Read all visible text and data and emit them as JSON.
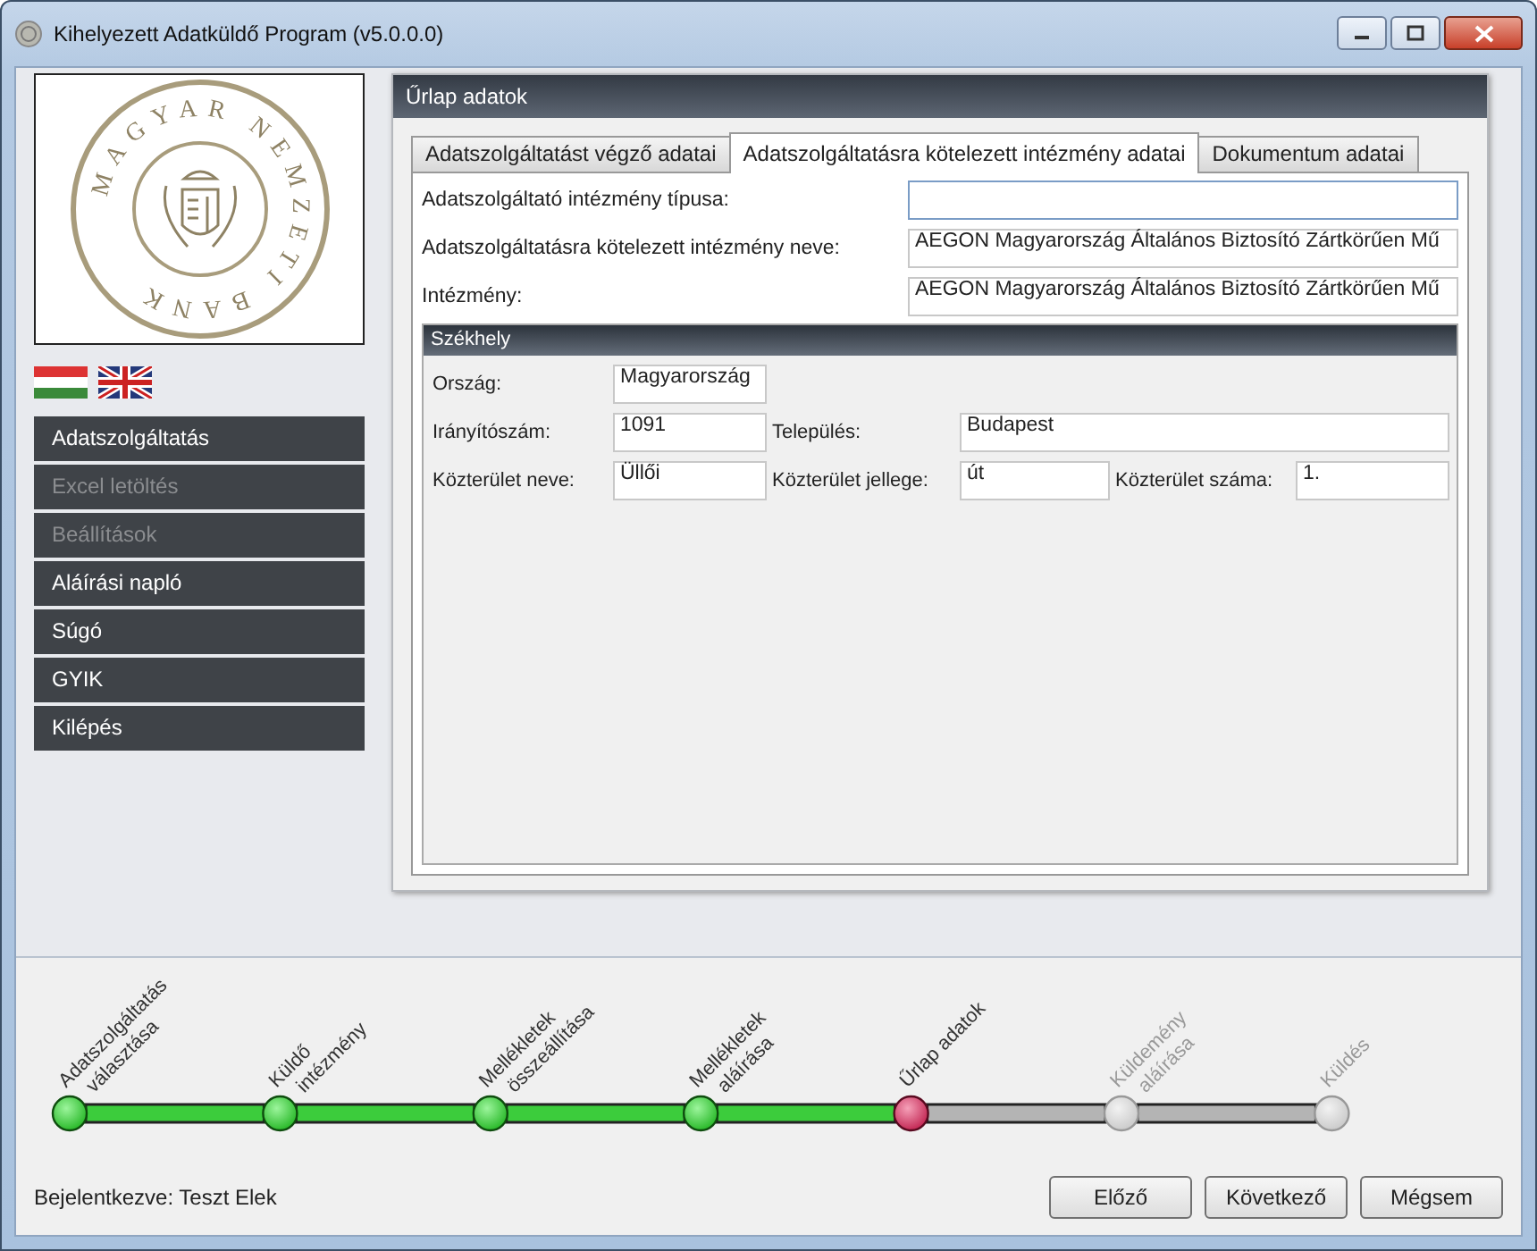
{
  "window": {
    "title": "Kihelyezett Adatküldő Program (v5.0.0.0)"
  },
  "logo": {
    "text": "MAGYAR NEMZETI BANK"
  },
  "menu": [
    {
      "label": "Adatszolgáltatás",
      "disabled": false
    },
    {
      "label": "Excel letöltés",
      "disabled": true
    },
    {
      "label": "Beállítások",
      "disabled": true
    },
    {
      "label": "Aláírási napló",
      "disabled": false
    },
    {
      "label": "Súgó",
      "disabled": false
    },
    {
      "label": "GYIK",
      "disabled": false
    },
    {
      "label": "Kilépés",
      "disabled": false
    }
  ],
  "panel": {
    "title": "Űrlap adatok",
    "tabs": [
      {
        "label": "Adatszolgáltatást végző adatai",
        "selected": false
      },
      {
        "label": "Adatszolgáltatásra kötelezett intézmény adatai",
        "selected": true
      },
      {
        "label": "Dokumentum adatai",
        "selected": false
      }
    ],
    "fields": [
      {
        "label": "Adatszolgáltató intézmény típusa:"
      },
      {
        "label": "Adatszolgáltatásra kötelezett intézmény neve:",
        "value": "AEGON Magyarország Általános Biztosító Zártkörűen Mű"
      },
      {
        "label": "Intézmény:",
        "value": "AEGON Magyarország Általános Biztosító Zártkörűen Mű"
      }
    ],
    "group": {
      "title": "Székhely",
      "rows": [
        [
          {
            "label": "Ország:",
            "value": "Magyarország"
          }
        ],
        [
          {
            "label": "Irányítószám:",
            "value": "1091"
          },
          {
            "label": "Település:",
            "value": "Budapest"
          }
        ],
        [
          {
            "label": "Közterület neve:",
            "value": "Üllői"
          },
          {
            "label": "Közterület jellege:",
            "value": "út"
          },
          {
            "label": "Közterület száma:",
            "value": "1."
          }
        ]
      ]
    }
  },
  "steps": [
    {
      "label": [
        "Adatszolgáltatás",
        "választása"
      ],
      "completed": true,
      "current": false
    },
    {
      "label": [
        "Küldő",
        "intézmény"
      ],
      "completed": true,
      "current": false
    },
    {
      "label": [
        "Mellékletek",
        "összeállítása"
      ],
      "completed": true,
      "current": false
    },
    {
      "label": [
        "Mellékletek",
        "aláírása"
      ],
      "completed": true,
      "current": false
    },
    {
      "label": [
        "Űrlap adatok"
      ],
      "completed": false,
      "current": true
    },
    {
      "label": [
        "Küldemény",
        "aláírása"
      ],
      "completed": false,
      "current": false
    },
    {
      "label": [
        "Küldés"
      ],
      "completed": false,
      "current": false
    }
  ],
  "status_bar": {
    "user_label": "Bejelentkezve:",
    "user": "Teszt Elek"
  },
  "buttons": [
    "Előző",
    "Következő",
    "Mégsem"
  ]
}
